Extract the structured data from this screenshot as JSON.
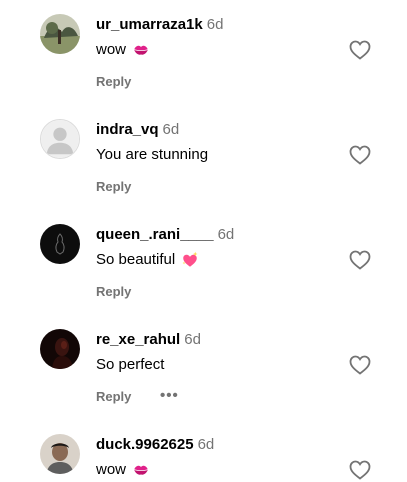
{
  "comments": [
    {
      "username": "ur_umarraza1k",
      "time": "6d",
      "text": "wow",
      "emoji": "kiss-mark-emoji",
      "reply": "Reply"
    },
    {
      "username": "indra_vq",
      "time": "6d",
      "text": "You are stunning",
      "reply": "Reply"
    },
    {
      "username": "queen_.rani____",
      "time": "6d",
      "text": "So beautiful",
      "emoji": "sparkling-heart-emoji",
      "reply": "Reply"
    },
    {
      "username": "re_xe_rahul",
      "time": "6d",
      "text": "So perfect",
      "reply": "Reply",
      "more": "•••"
    },
    {
      "username": "duck.9962625",
      "time": "6d",
      "text": "wow",
      "emoji": "kiss-mark-emoji"
    }
  ],
  "colors": {
    "secondary_text": "#737373",
    "kiss_emoji": "#e0218a",
    "heart_emoji": "#ff4f8b"
  },
  "icons": {
    "like": "heart-outline-icon",
    "default_avatar": "person-silhouette-icon"
  }
}
